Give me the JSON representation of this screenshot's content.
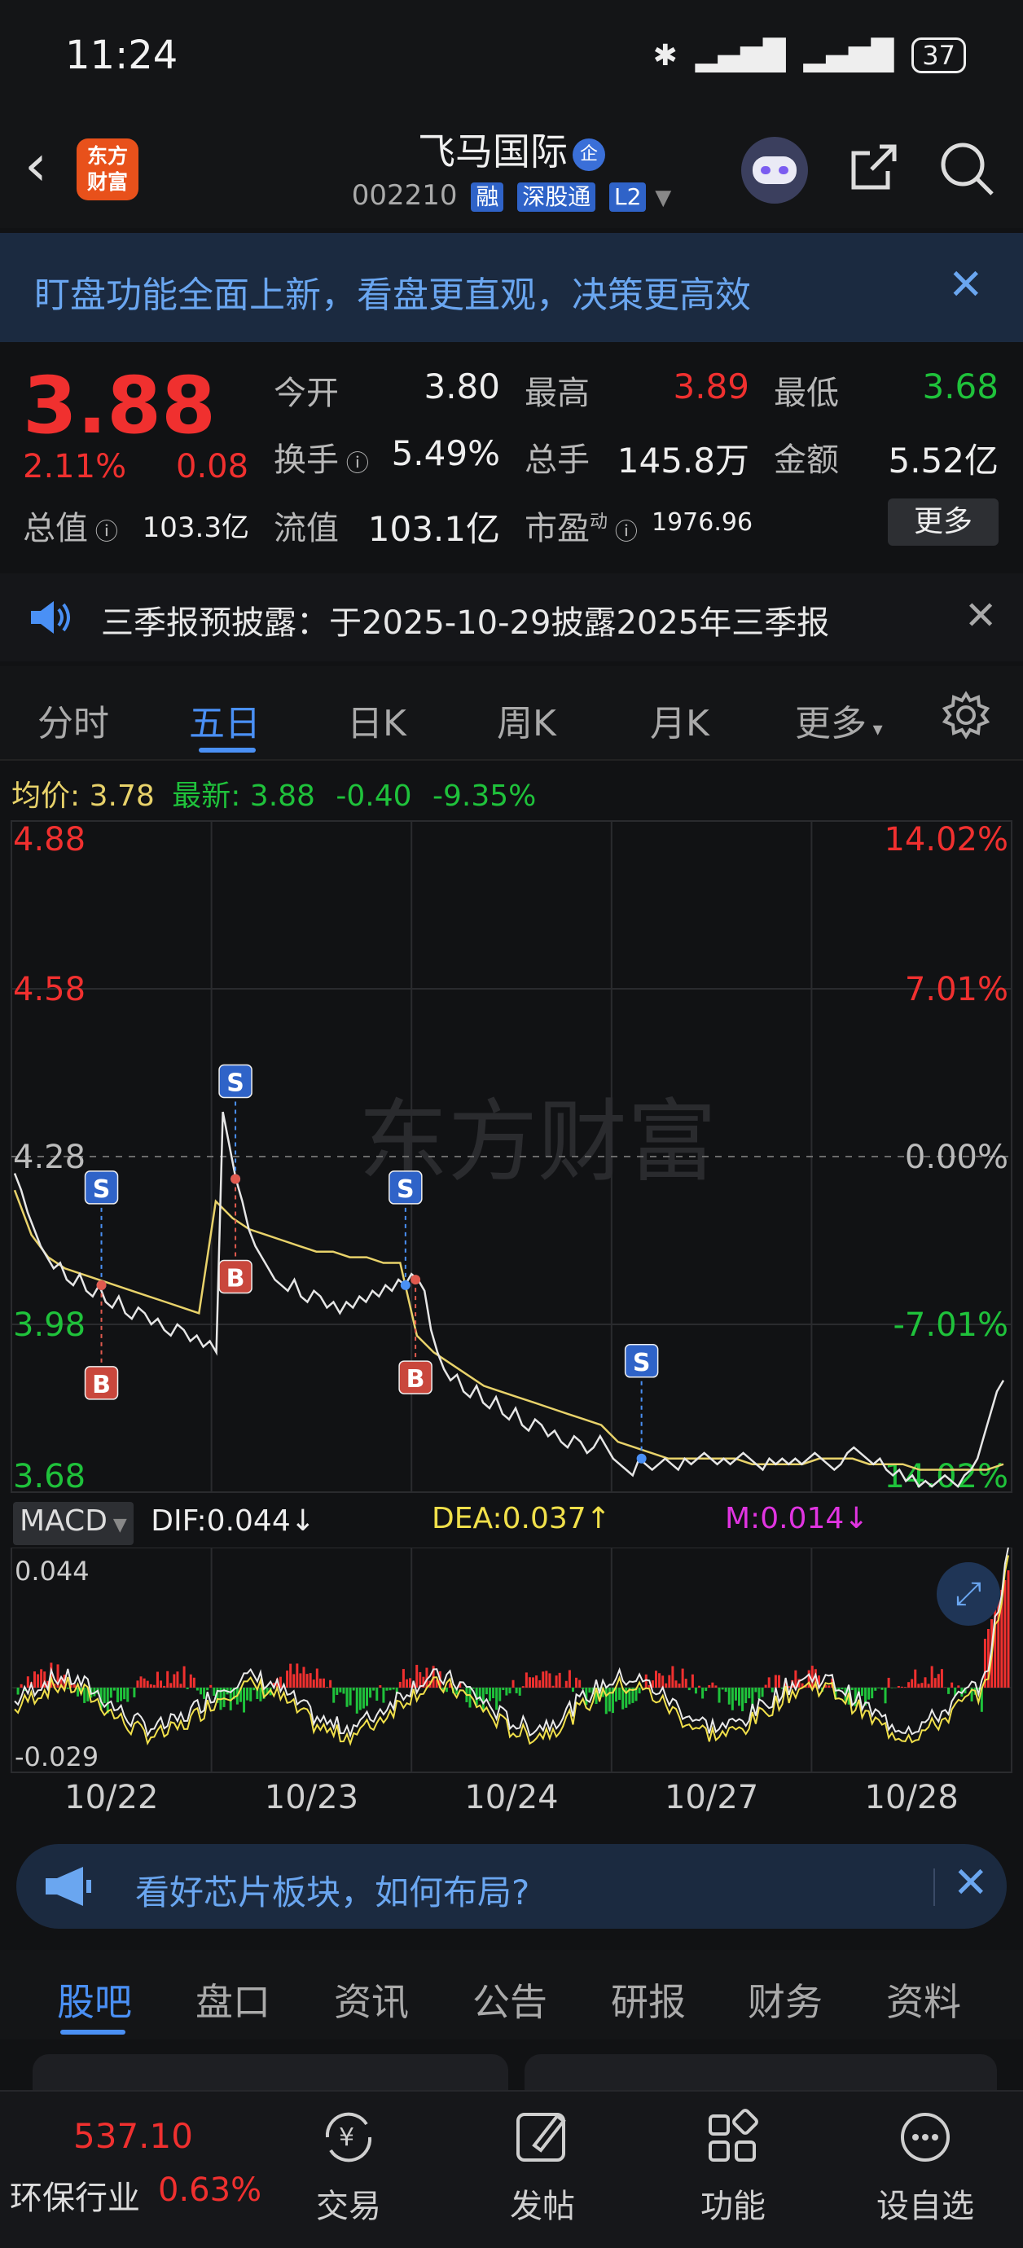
{
  "status_bar": {
    "time": "11:24",
    "battery": "37"
  },
  "header": {
    "logo_line1": "东方",
    "logo_line2": "财富",
    "stock_name": "飞马国际",
    "qi_badge": "企",
    "code": "002210",
    "tags": [
      "融",
      "深股通",
      "L2"
    ]
  },
  "banner": {
    "text": "盯盘功能全面上新，看盘更直观，决策更高效"
  },
  "quote": {
    "price": "3.88",
    "pct": "2.11%",
    "change": "0.08",
    "fields": [
      {
        "label": "今开",
        "value": "3.80"
      },
      {
        "label": "最高",
        "value": "3.89"
      },
      {
        "label": "最低",
        "value": "3.68"
      },
      {
        "label": "换手",
        "value": "5.49%"
      },
      {
        "label": "总手",
        "value": "145.8万"
      },
      {
        "label": "金额",
        "value": "5.52亿"
      },
      {
        "label": "总值",
        "value": "103.3亿"
      },
      {
        "label": "流值",
        "value": "103.1亿"
      },
      {
        "label": "市盈",
        "value": "1976.96"
      }
    ],
    "pe_sup": "动",
    "more_label": "更多"
  },
  "announcement": {
    "text": "三季报预披露：于2025-10-29披露2025年三季报"
  },
  "tabs": [
    "分时",
    "五日",
    "日K",
    "周K",
    "月K",
    "更多"
  ],
  "avg_line": {
    "avg_label": "均价:",
    "avg_value": "3.78",
    "latest_label": "最新:",
    "latest_value": "3.88",
    "change": "-0.40",
    "pct": "-9.35%"
  },
  "colors": {
    "up": "#f0302f",
    "down": "#1fc23b",
    "accent": "#4a90f5",
    "avg": "#e8d26a",
    "dea": "#f1e04a",
    "m": "#e034e0"
  },
  "chart_data": {
    "type": "line",
    "days": [
      "10/22",
      "10/23",
      "10/24",
      "10/27",
      "10/28"
    ],
    "price_ticks": [
      "4.88",
      "4.58",
      "4.28",
      "3.98",
      "3.68"
    ],
    "pct_ticks": [
      "14.02%",
      "7.01%",
      "0.00%",
      "-7.01%",
      "14.02%"
    ],
    "ylim": [
      3.68,
      4.88
    ],
    "prev_close": 4.28,
    "series": [
      {
        "name": "价格",
        "values": [
          4.25,
          4.22,
          4.18,
          4.15,
          4.12,
          4.1,
          4.08,
          4.09,
          4.06,
          4.05,
          4.07,
          4.04,
          4.03,
          4.05,
          4.02,
          4.01,
          4.03,
          4.0,
          3.99,
          4.01,
          4.0,
          3.98,
          3.99,
          3.97,
          3.96,
          3.98,
          3.97,
          3.95,
          3.96,
          3.94,
          3.95,
          3.93,
          4.36,
          4.3,
          4.24,
          4.2,
          4.15,
          4.12,
          4.1,
          4.08,
          4.06,
          4.05,
          4.04,
          4.06,
          4.03,
          4.02,
          4.04,
          4.03,
          4.01,
          4.02,
          4.0,
          4.02,
          4.01,
          4.03,
          4.02,
          4.04,
          4.03,
          4.05,
          4.04,
          4.06,
          4.05,
          4.07,
          4.06,
          4.04,
          3.97,
          3.93,
          3.9,
          3.88,
          3.89,
          3.86,
          3.85,
          3.87,
          3.84,
          3.83,
          3.85,
          3.82,
          3.81,
          3.83,
          3.8,
          3.79,
          3.81,
          3.8,
          3.78,
          3.79,
          3.77,
          3.76,
          3.78,
          3.77,
          3.75,
          3.76,
          3.78,
          3.76,
          3.74,
          3.73,
          3.72,
          3.71,
          3.74,
          3.73,
          3.72,
          3.73,
          3.74,
          3.73,
          3.72,
          3.74,
          3.73,
          3.74,
          3.75,
          3.74,
          3.73,
          3.74,
          3.73,
          3.74,
          3.75,
          3.74,
          3.73,
          3.72,
          3.74,
          3.73,
          3.74,
          3.73,
          3.74,
          3.73,
          3.74,
          3.75,
          3.74,
          3.73,
          3.72,
          3.73,
          3.75,
          3.76,
          3.75,
          3.74,
          3.73,
          3.74,
          3.72,
          3.71,
          3.72,
          3.7,
          3.71,
          3.69,
          3.7,
          3.69,
          3.7,
          3.71,
          3.7,
          3.69,
          3.71,
          3.72,
          3.74,
          3.78,
          3.82,
          3.86,
          3.88
        ]
      },
      {
        "name": "均价",
        "values": [
          4.22,
          4.14,
          4.1,
          4.08,
          4.07,
          4.06,
          4.05,
          4.04,
          4.03,
          4.02,
          4.01,
          4.0,
          4.2,
          4.17,
          4.15,
          4.14,
          4.13,
          4.12,
          4.11,
          4.11,
          4.1,
          4.1,
          4.09,
          4.09,
          3.96,
          3.93,
          3.91,
          3.89,
          3.87,
          3.86,
          3.85,
          3.84,
          3.83,
          3.82,
          3.81,
          3.8,
          3.77,
          3.76,
          3.75,
          3.74,
          3.74,
          3.74,
          3.74,
          3.74,
          3.73,
          3.73,
          3.73,
          3.73,
          3.74,
          3.74,
          3.74,
          3.73,
          3.73,
          3.73,
          3.72,
          3.72,
          3.72,
          3.72,
          3.72,
          3.73
        ]
      }
    ],
    "markers": [
      {
        "label": "S",
        "day": 0,
        "pos": 0.45
      },
      {
        "label": "B",
        "day": 0,
        "pos": 0.45
      },
      {
        "label": "S",
        "day": 1,
        "pos": 0.12
      },
      {
        "label": "B",
        "day": 1,
        "pos": 0.12
      },
      {
        "label": "S",
        "day": 1,
        "pos": 0.97
      },
      {
        "label": "B",
        "day": 2,
        "pos": 0.02
      },
      {
        "label": "S",
        "day": 3,
        "pos": 0.15
      }
    ]
  },
  "macd": {
    "selector": "MACD",
    "dif": "DIF:0.044",
    "dea": "DEA:0.037",
    "m": "M:0.014",
    "top_tick": "0.044",
    "bottom_tick": "-0.029"
  },
  "promo": {
    "text": "看好芯片板块，如何布局?"
  },
  "bottom_tabs": [
    "股吧",
    "盘口",
    "资讯",
    "公告",
    "研报",
    "财务",
    "资料"
  ],
  "nav": {
    "index_value": "537.10",
    "index_name": "环保行业",
    "index_pct": "0.63%",
    "items": [
      {
        "label": "交易",
        "icon": "yuan-exchange-icon"
      },
      {
        "label": "发帖",
        "icon": "edit-icon"
      },
      {
        "label": "功能",
        "icon": "grid-icon"
      },
      {
        "label": "设自选",
        "icon": "more-dots-icon"
      }
    ]
  }
}
